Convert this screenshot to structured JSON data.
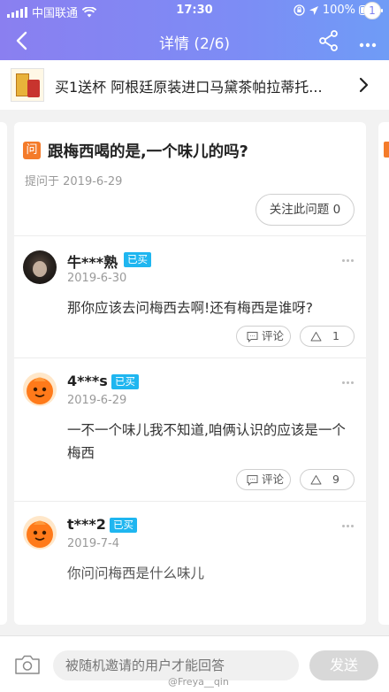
{
  "status_bar": {
    "carrier": "中国联通",
    "time": "17:30",
    "battery": "100%",
    "battery_level": 1.0
  },
  "nav": {
    "title": "详情 (2/6)",
    "badge_count": "1"
  },
  "product": {
    "title": "买1送杯 阿根廷原装进口马黛茶帕拉蒂托..."
  },
  "question": {
    "icon_label": "问",
    "title": "跟梅西喝的是,一个味儿的吗?",
    "date": "提问于 2019-6-29",
    "follow_label": "关注此问题 0"
  },
  "answers": [
    {
      "user": "牛***熟",
      "badge": "已买",
      "date": "2019-6-30",
      "text": "那你应该去问梅西去啊!还有梅西是谁呀?",
      "comment_label": "评论",
      "likes": "1"
    },
    {
      "user": "4***s",
      "badge": "已买",
      "date": "2019-6-29",
      "text": "一不一个味儿我不知道,咱俩认识的应该是一个梅西",
      "comment_label": "评论",
      "likes": "9"
    },
    {
      "user": "t***2",
      "badge": "已买",
      "date": "2019-7-4",
      "text": "你问问梅西是什么味儿"
    }
  ],
  "bottom": {
    "placeholder": "被随机邀请的用户才能回答",
    "send_label": "发送"
  },
  "watermark": "@Freya__qin",
  "colors": {
    "header_gradient_start": "#8a7ff0",
    "header_gradient_end": "#6f9cf6",
    "question_icon": "#f47b2a",
    "bought_badge": "#1fb6f0",
    "send_disabled": "#d8d8d8"
  }
}
